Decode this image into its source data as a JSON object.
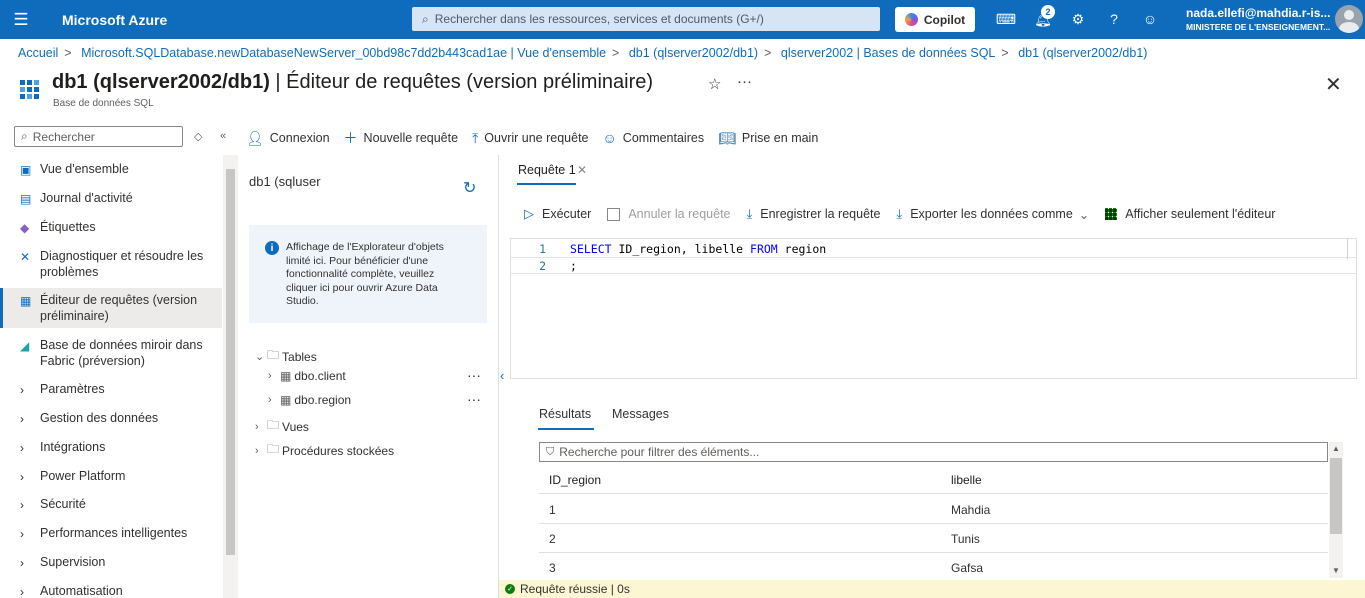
{
  "topbar": {
    "brand": "Microsoft Azure",
    "search_placeholder": "Rechercher dans les ressources, services et documents (G+/)",
    "copilot_label": "Copilot",
    "notification_count": "2",
    "user_email": "nada.ellefi@mahdia.r-is...",
    "user_org": "MINISTERE DE L'ENSEIGNEMENT..."
  },
  "breadcrumb": [
    "Accueil",
    "Microsoft.SQLDatabase.newDatabaseNewServer_00bd98c7dd2b443cad1ae | Vue d'ensemble",
    "db1 (qlserver2002/db1)",
    "qlserver2002 | Bases de données SQL",
    "db1 (qlserver2002/db1)"
  ],
  "header": {
    "title_bold": "db1 (qlserver2002/db1)",
    "title_rest": " | Éditeur de requêtes (version préliminaire)",
    "subtitle": "Base de données SQL",
    "more": "···"
  },
  "sidebar": {
    "search_placeholder": "Rechercher",
    "items": [
      {
        "label": "Vue d'ensemble",
        "icon": "sql-icon"
      },
      {
        "label": "Journal d'activité",
        "icon": "log-icon"
      },
      {
        "label": "Étiquettes",
        "icon": "tag-icon"
      },
      {
        "label": "Diagnostiquer et résoudre les problèmes",
        "icon": "wrench-icon"
      },
      {
        "label": "Éditeur de requêtes (version préliminaire)",
        "icon": "query-editor-icon"
      },
      {
        "label": "Base de données miroir dans Fabric (préversion)",
        "icon": "fabric-icon"
      },
      {
        "label": "Paramètres",
        "icon": "chevron-right-icon"
      },
      {
        "label": "Gestion des données",
        "icon": "chevron-right-icon"
      },
      {
        "label": "Intégrations",
        "icon": "chevron-right-icon"
      },
      {
        "label": "Power Platform",
        "icon": "chevron-right-icon"
      },
      {
        "label": "Sécurité",
        "icon": "chevron-right-icon"
      },
      {
        "label": "Performances intelligentes",
        "icon": "chevron-right-icon"
      },
      {
        "label": "Supervision",
        "icon": "chevron-right-icon"
      },
      {
        "label": "Automatisation",
        "icon": "chevron-right-icon"
      }
    ]
  },
  "commandbar": {
    "connexion": "Connexion",
    "new_query": "Nouvelle requête",
    "open_query": "Ouvrir une requête",
    "feedback": "Commentaires",
    "getting_started": "Prise en main"
  },
  "explorer": {
    "title": "db1 (sqluser",
    "info": "Affichage de l'Explorateur d'objets limité ici. Pour bénéficier d'une fonctionnalité complète, veuillez cliquer ici pour ouvrir Azure Data Studio.",
    "tables": "Tables",
    "table_items": [
      "dbo.client",
      "dbo.region"
    ],
    "views": "Vues",
    "procs": "Procédures stockées",
    "dots": "···"
  },
  "query": {
    "tab_label": "Requête 1",
    "run": "Exécuter",
    "cancel": "Annuler la requête",
    "save": "Enregistrer la requête",
    "export": "Exporter les données comme",
    "show_editor_only": "Afficher seulement l'éditeur",
    "line_numbers": [
      "1",
      "2"
    ],
    "code_kw1": "SELECT",
    "code_mid": " ID_region, libelle ",
    "code_kw2": "FROM",
    "code_end": " region",
    "code_line2": ";"
  },
  "results": {
    "tab_results": "Résultats",
    "tab_messages": "Messages",
    "filter_placeholder": "Recherche pour filtrer des éléments...",
    "columns": [
      "ID_region",
      "libelle"
    ],
    "rows": [
      [
        "1",
        "Mahdia"
      ],
      [
        "2",
        "Tunis"
      ],
      [
        "3",
        "Gafsa"
      ]
    ]
  },
  "status": {
    "text": "Requête réussie | 0s",
    "color": "#107c10"
  }
}
